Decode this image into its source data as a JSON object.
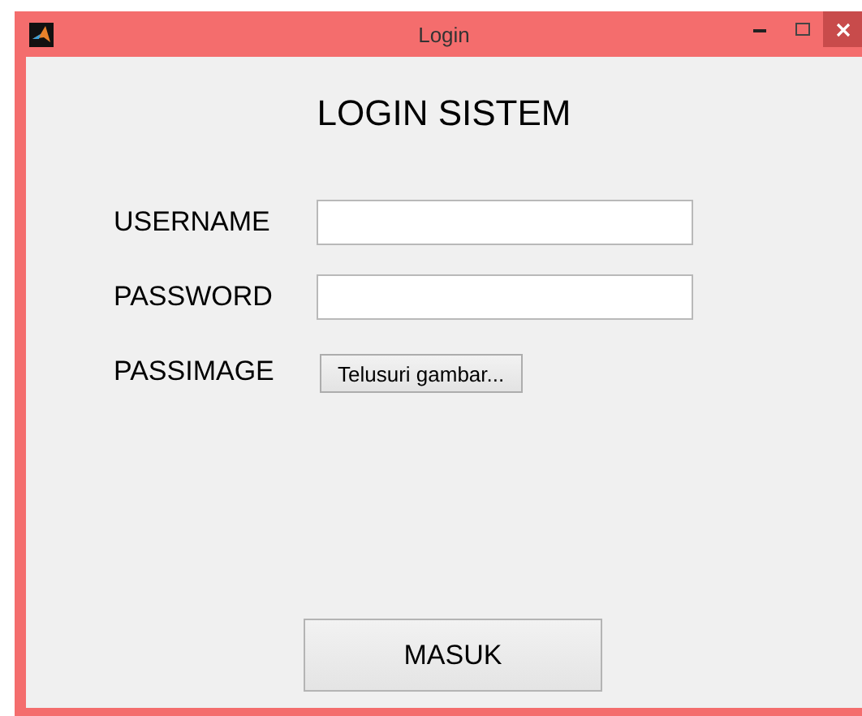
{
  "window": {
    "title": "Login"
  },
  "heading": "LOGIN SISTEM",
  "fields": [
    {
      "label": "USERNAME",
      "kind": "text"
    },
    {
      "label": "PASSWORD",
      "kind": "text"
    },
    {
      "label": "PASSIMAGE",
      "kind": "browse",
      "button": "Telusuri gambar..."
    }
  ],
  "submit": "MASUK"
}
